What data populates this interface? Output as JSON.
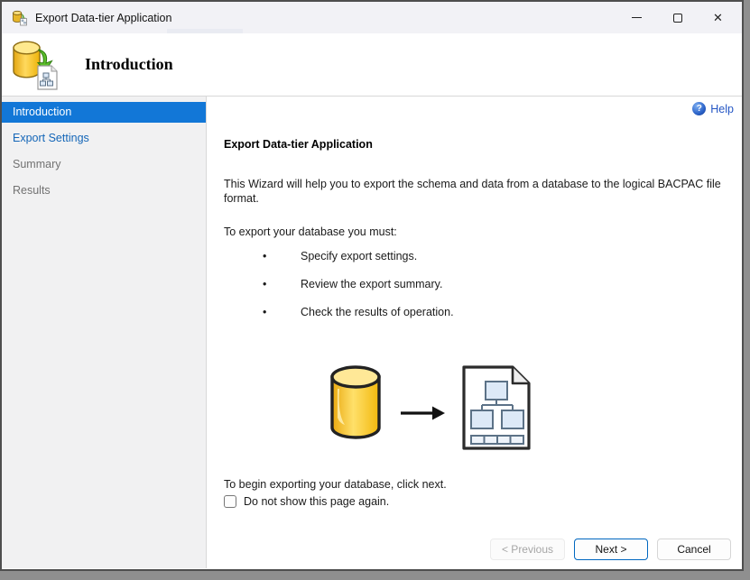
{
  "window": {
    "title": "Export Data-tier Application"
  },
  "titlebar_controls": {
    "close_glyph": "✕"
  },
  "header": {
    "title": "Introduction"
  },
  "sidebar": {
    "items": [
      {
        "label": "Introduction",
        "state": "selected"
      },
      {
        "label": "Export Settings",
        "state": "enabled-link"
      },
      {
        "label": "Summary",
        "state": "disabled"
      },
      {
        "label": "Results",
        "state": "disabled"
      }
    ]
  },
  "content": {
    "help_label": "Help",
    "help_icon_glyph": "?",
    "heading": "Export Data-tier Application",
    "intro": "This Wizard will help you to export the schema and data from a database to the logical BACPAC file format.",
    "list_intro": "To export your database you must:",
    "bullet_glyph": "•",
    "bullets": [
      {
        "text": "Specify export settings."
      },
      {
        "text": "Review the export summary."
      },
      {
        "text": "Check the results of operation."
      }
    ],
    "footer_text": "To begin exporting your database, click next.",
    "checkbox": {
      "label": "Do not show this page again.",
      "checked": false
    }
  },
  "buttons": {
    "previous": "< Previous",
    "next": "Next >",
    "cancel": "Cancel"
  },
  "colors": {
    "selected_item_bg": "#1277d7",
    "sidebar_link_blue": "#1466b8",
    "help_blue": "#2456c4",
    "next_button_border": "#0067c0",
    "database_gold": "#f0b400",
    "arrow_green": "#58b928"
  }
}
